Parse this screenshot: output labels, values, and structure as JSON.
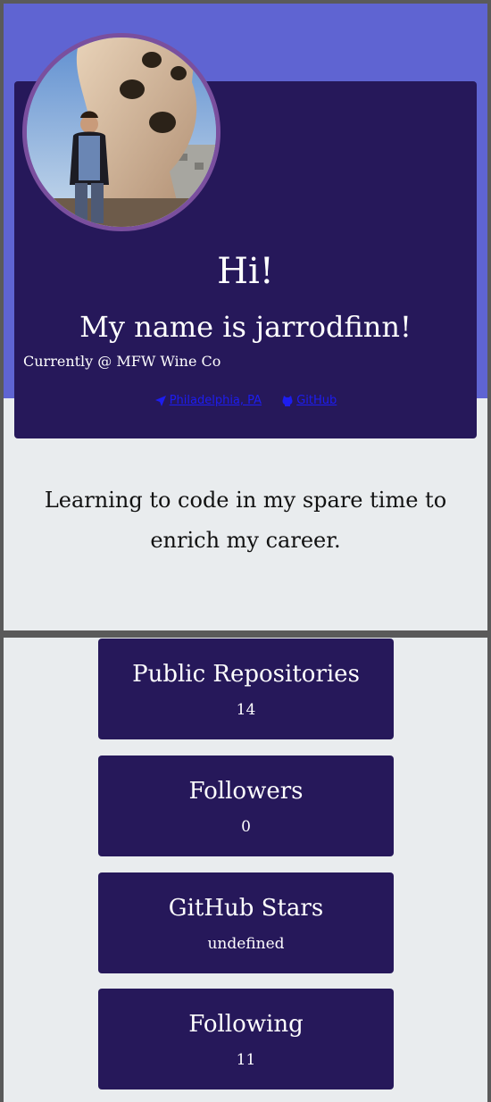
{
  "profile": {
    "greeting": "Hi!",
    "name_line": "My name is jarrodfinn!",
    "company_line": "Currently @ MFW Wine Co",
    "location": "Philadelphia, PA",
    "github_link": "GitHub",
    "bio": "Learning to code in my spare time to enrich my career."
  },
  "stats": [
    {
      "label": "Public Repositories",
      "value": "14"
    },
    {
      "label": "Followers",
      "value": "0"
    },
    {
      "label": "GitHub Stars",
      "value": "undefined"
    },
    {
      "label": "Following",
      "value": "11"
    }
  ],
  "icons": {
    "location": "location-arrow-icon",
    "github": "github-icon"
  },
  "colors": {
    "hero": "#5f64d2",
    "card": "#26185a",
    "page": "#e9ecee",
    "link": "#1d1df0",
    "avatar_border": "#7a4f9e"
  }
}
